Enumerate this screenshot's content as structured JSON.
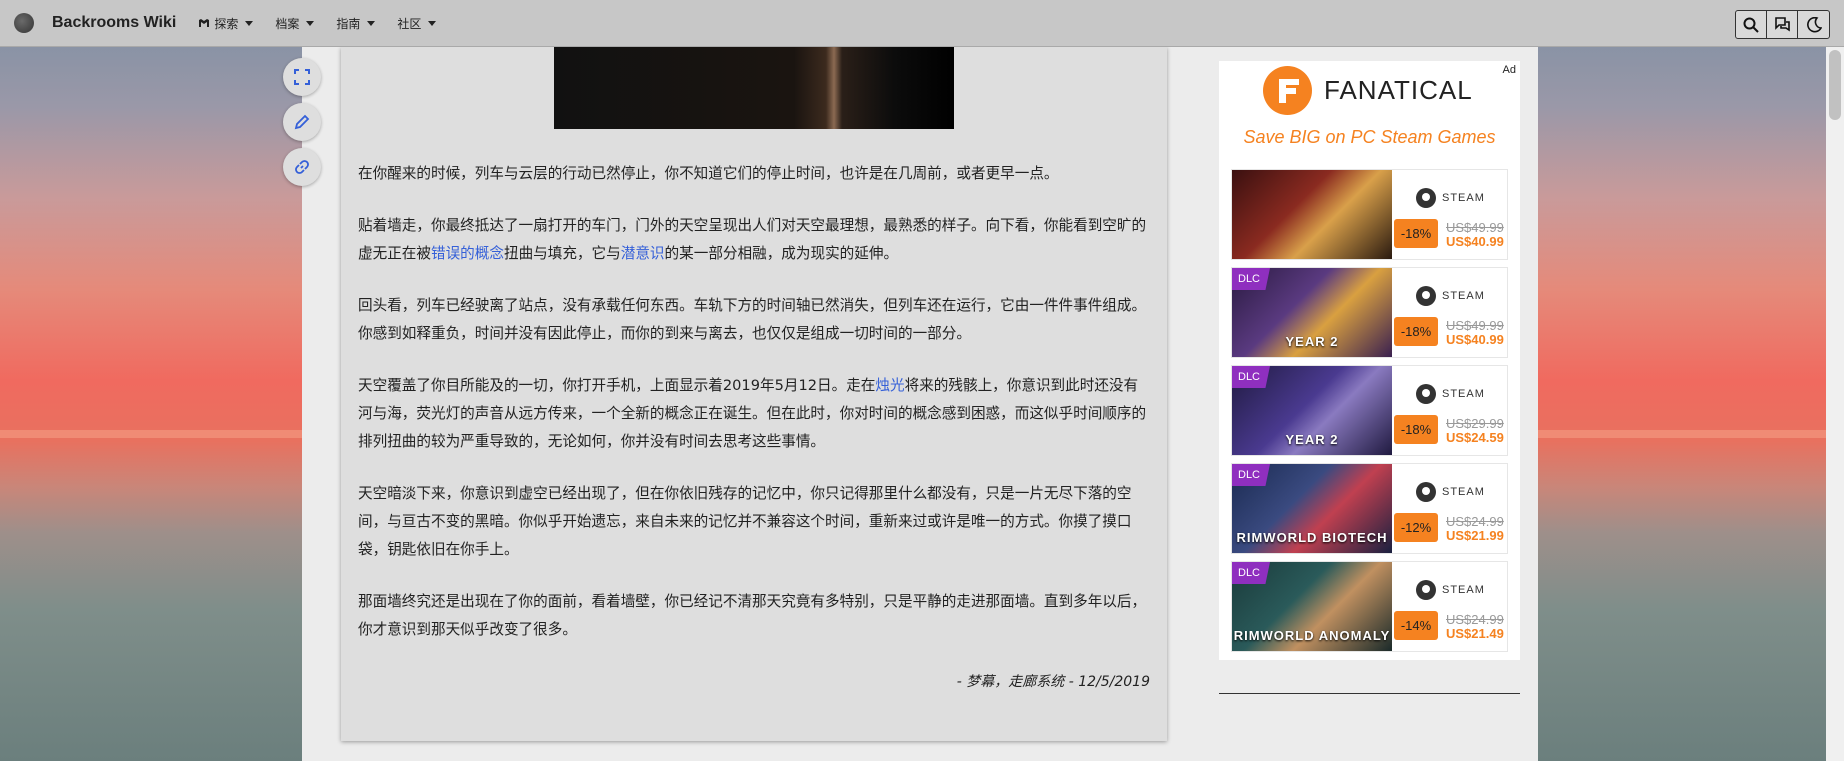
{
  "site": {
    "title": "Backrooms Wiki"
  },
  "menu": [
    {
      "label": "探索",
      "icon": "backrooms-b-icon"
    },
    {
      "label": "档案"
    },
    {
      "label": "指南"
    },
    {
      "label": "社区"
    }
  ],
  "tools": [
    "search-icon",
    "chat-icon",
    "dark-mode-icon"
  ],
  "side_buttons": [
    "fullscreen-icon",
    "edit-icon",
    "link-icon"
  ],
  "article": {
    "p1": "在你醒来的时候，列车与云层的行动已然停止，你不知道它们的停止时间，也许是在几周前，或者更早一点。",
    "p2_a": "贴着墙走，你最终抵达了一扇打开的车门，门外的天空呈现出人们对天空最理想，最熟悉的样子。向下看，你能看到空旷的虚无正在被",
    "p2_link1": "错误的概念",
    "p2_b": "扭曲与填充，它与",
    "p2_link2": "潜意识",
    "p2_c": "的某一部分相融，成为现实的延伸。",
    "p3": "回头看，列车已经驶离了站点，没有承载任何东西。车轨下方的时间轴已然消失，但列车还在运行，它由一件件事件组成。你感到如释重负，时间并没有因此停止，而你的到来与离去，也仅仅是组成一切时间的一部分。",
    "p4_a": "天空覆盖了你目所能及的一切，你打开手机，上面显示着2019年5月12日。走在",
    "p4_link": "烛光",
    "p4_b": "将来的残骸上，你意识到此时还没有河与海，荧光灯的声音从远方传来，一个全新的概念正在诞生。但在此时，你对时间的概念感到困惑，而这似乎时间顺序的排列扭曲的较为严重导致的，无论如何，你并没有时间去思考这些事情。",
    "p5": "天空暗淡下来，你意识到虚空已经出现了，但在你依旧残存的记忆中，你只记得那里什么都没有，只是一片无尽下落的空间，与亘古不变的黑暗。你似乎开始遗忘，来自未来的记忆并不兼容这个时间，重新来过或许是唯一的方式。你摸了摸口袋，钥匙依旧在你手上。",
    "p6": "那面墙终究还是出现在了你的面前，看着墙壁，你已经记不清那天究竟有多特别，只是平静的走进那面墙。直到多年以后，你才意识到那天似乎改变了很多。",
    "signature": "- 梦幕，走廊系统 - 12/5/2019"
  },
  "ad": {
    "badge": "Ad",
    "brand": "FANATICAL",
    "tagline": "Save BIG on PC Steam Games",
    "platform": "STEAM",
    "games": [
      {
        "dlc": "",
        "art_label": "",
        "discount": "-18%",
        "old_price": "US$49.99",
        "new_price": "US$40.99",
        "art": "linear-gradient(135deg,#3a1010,#8a2a20 40%,#d9a04a 60%,#2a1a10)"
      },
      {
        "dlc": "DLC",
        "art_label": "YEAR 2",
        "discount": "-18%",
        "old_price": "US$49.99",
        "new_price": "US$40.99",
        "art": "linear-gradient(135deg,#2a1a40,#5a3a80 40%,#d9a040 60%,#3a2050)"
      },
      {
        "dlc": "DLC",
        "art_label": "YEAR 2",
        "discount": "-18%",
        "old_price": "US$29.99",
        "new_price": "US$24.59",
        "art": "linear-gradient(135deg,#201a40,#4a3a90 45%,#8a7ac0 60%,#201a40)"
      },
      {
        "dlc": "DLC",
        "art_label": "RIMWORLD BIOTECH",
        "discount": "-12%",
        "old_price": "US$24.99",
        "new_price": "US$21.99",
        "art": "linear-gradient(135deg,#1a2a50,#3a4a80 40%,#c04050 60%,#1a2040)"
      },
      {
        "dlc": "DLC",
        "art_label": "RIMWORLD ANOMALY",
        "discount": "-14%",
        "old_price": "US$24.99",
        "new_price": "US$21.49",
        "art": "linear-gradient(135deg,#1a3a3a,#2a5a5a 40%,#c09060 60%,#1a2a2a)"
      }
    ]
  }
}
